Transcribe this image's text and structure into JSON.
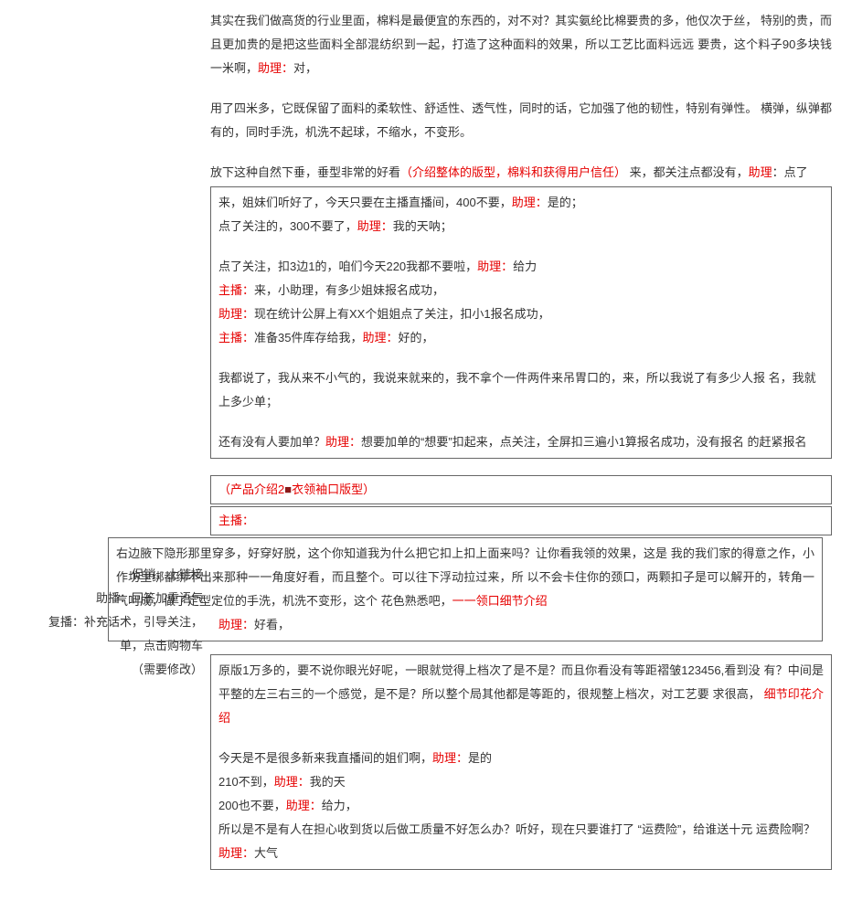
{
  "top": {
    "p1a": "其实在我们做高货的行业里面，棉料是最便宜的东西的，对不对？其实氨纶比棉要贵的多，他仅次于丝，   特别的贵，而且更加贵的是把这些面料全部混纺织到一起，打造了这种面料的效果，所以工艺比面料远远  要贵，这个料子90多块钱一米啊，",
    "p1_asst": "助理：",
    "p1b": "对，",
    "p2": "用了四米多，它既保留了面料的柔软性、舒适性、透气性，同时的话，它加强了他的韧性，特别有弹性。  横弹，纵弹都有的，同时手洗，机洗不起球，不缩水，不变形。",
    "p3a": "放下这种自然下垂，垂型非常的好看",
    "p3_note": "（介绍整体的版型，棉料和获得用户信任）",
    "p3b": " 来，都关注点都没有，",
    "p3_asst_lbl": "助理",
    "p3c": "：点了"
  },
  "box1": {
    "l1a": "来，姐妹们听好了，今天只要在主播直播间，400不要，",
    "l1_asst": "助理：",
    "l1b": "是的；",
    "l2a": "点了关注的，300不要了，",
    "l2_asst": "助理：",
    "l2b": "我的天呐；",
    "l3a": "点了关注，扣3边1的，咱们今天220我都不要啦，",
    "l3_asst": "助理：",
    "l3b": "给力",
    "l4_host": "主播：",
    "l4": "来，小助理，有多少姐妹报名成功，",
    "l5_asst": "助理：",
    "l5": "现在统计公屏上有XX个姐姐点了关注，扣小1报名成功，",
    "l6_host": "主播：",
    "l6a": "准备35件库存给我，",
    "l6_asst": "助理：",
    "l6b": "好的，",
    "l7": "我都说了，我从来不小气的，我说来就来的，我不拿个一件两件来吊胃口的，来，所以我说了有多少人报  名，我就上多少单；",
    "l8a": "还有没有人要加单？",
    "l8_asst": "助理：",
    "l8b": "想要加单的“想要”扣起来，点关注，全屏扣三遍小1算报名成功，没有报名  的赶紧报名"
  },
  "box2": {
    "title": "（产品介绍2■衣领袖口版型）"
  },
  "box3": {
    "host": "主播："
  },
  "widebox": {
    "p1": "右边腋下隐形那里穿多，好穿好脱，这个你知道我为什么把它扣上扣上面来吗？让你看我领的效果，这是  我的我们家的得意之作，小作坊里绑都绑不出来那种一一角度好看，而且整个。可以往下浮动拉过来，所  以不会卡住你的颈口，两颗扣子是可以解开的，转角一气呵成，做了定型定位的手洗，机洗不变形，这个  花色熟悉吧，",
    "p1_note": "一一领口细节介绍",
    "asst_lbl": "助理：",
    "asst_txt": "好看，"
  },
  "left": {
    "n1": "促销，上链接",
    "n2": "助播：回答加重语气",
    "n3": "复播：补充话术，引导关注，",
    "n4": "单，点击购物车",
    "n5": "（需要修改）"
  },
  "box4": {
    "p1a": "原版1万多的，要不说你眼光好呢，一眼就觉得上档次了是不是？而且你看没有等距褶皱123456,看到没  有？中间是平整的左三右三的一个感觉，是不是？所以整个局其他都是等距的，很规整上档次，对工艺要  求很高，",
    "p1_note": "    细节印花介绍",
    "l2a": "今天是不是很多新来我直播间的姐们啊，",
    "l2_asst": "助理：",
    "l2b": "是的",
    "l3a": "210不到，",
    "l3_asst": "助理：",
    "l3b": "我的天",
    "l4a": "200也不要，",
    "l4_asst": "助理：",
    "l4b": "给力，",
    "l5": "所以是不是有人在担心收到货以后做工质量不好怎么办？听好，现在只要谁打了 “运费险”，给谁送十元  运费险啊？",
    "l6_asst": "助理：",
    "l6": "大气"
  }
}
